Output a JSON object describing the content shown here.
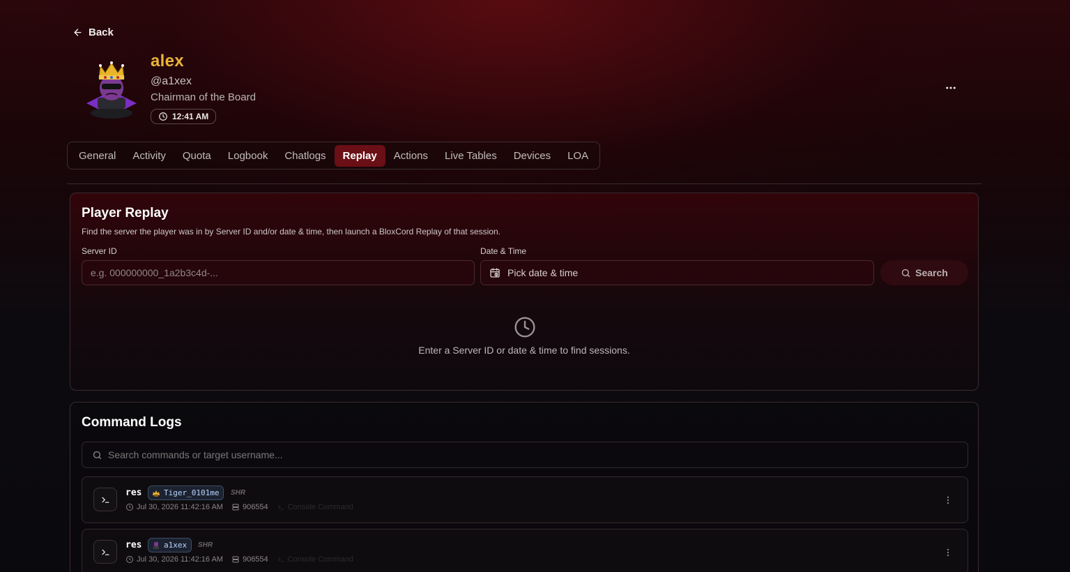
{
  "nav": {
    "back_label": "Back"
  },
  "profile": {
    "display_name": "alex",
    "handle": "@a1xex",
    "rank": "Chairman of the Board",
    "local_time": "12:41 AM"
  },
  "tabs": [
    {
      "label": "General"
    },
    {
      "label": "Activity"
    },
    {
      "label": "Quota"
    },
    {
      "label": "Logbook"
    },
    {
      "label": "Chatlogs"
    },
    {
      "label": "Replay",
      "active": true
    },
    {
      "label": "Actions"
    },
    {
      "label": "Live Tables"
    },
    {
      "label": "Devices"
    },
    {
      "label": "LOA"
    }
  ],
  "replay": {
    "title": "Player Replay",
    "description": "Find the server the player was in by Server ID and/or date & time, then launch a BloxCord Replay of that session.",
    "server_id_label": "Server ID",
    "server_id_placeholder": "e.g. 000000000_1a2b3c4d-...",
    "datetime_label": "Date & Time",
    "datetime_placeholder": "Pick date & time",
    "search_label": "Search",
    "empty_text": "Enter a Server ID or date & time to find sessions."
  },
  "logs": {
    "title": "Command Logs",
    "search_placeholder": "Search commands or target username...",
    "rows": [
      {
        "command": "res",
        "target": "Tiger_0101me",
        "tag": "SHR",
        "timestamp": "Jul 30, 2026 11:42:16 AM",
        "server": "906554",
        "source": "Console Command"
      },
      {
        "command": "res",
        "target": "a1xex",
        "tag": "SHR",
        "timestamp": "Jul 30, 2026 11:42:16 AM",
        "server": "906554",
        "source": "Console Command"
      }
    ]
  },
  "colors": {
    "accent": "#6b0f16",
    "display_name": "#e9b43b",
    "chip_text": "#b9d5ff"
  },
  "icons": [
    "arrow-left-icon",
    "clock-icon",
    "more-horizontal-icon",
    "calendar-icon",
    "search-icon",
    "terminal-icon",
    "server-icon",
    "more-vertical-icon"
  ]
}
